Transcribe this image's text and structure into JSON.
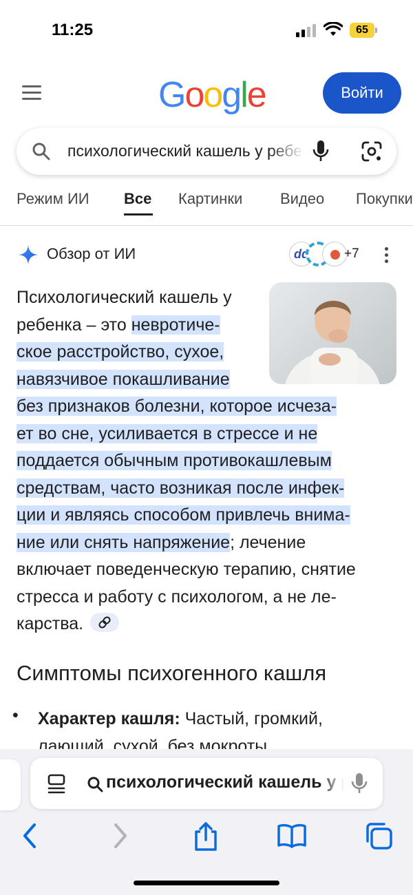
{
  "status_bar": {
    "time": "11:25",
    "battery": "65"
  },
  "header": {
    "logo": [
      "G",
      "o",
      "o",
      "g",
      "l",
      "e"
    ],
    "logo_colors": [
      "#4285F4",
      "#EA4335",
      "#FBBC05",
      "#4285F4",
      "#34A853",
      "#EA4335"
    ],
    "login_label": "Войти"
  },
  "search": {
    "query": "психологический кашель у ребенка"
  },
  "tabs": [
    {
      "label": "Режим ИИ"
    },
    {
      "label": "Все",
      "active": true
    },
    {
      "label": "Картинки"
    },
    {
      "label": "Видео"
    },
    {
      "label": "Покупки"
    }
  ],
  "ai_overview": {
    "title": "Обзор от ИИ",
    "sources_more": "+7",
    "source_logo_text": "dd",
    "lines": [
      {
        "pre": "Психологический кашель у",
        "hl": "",
        "post": ""
      },
      {
        "pre": "ребенка – это ",
        "hl": "невротиче-",
        "post": ""
      },
      {
        "pre": "",
        "hl": "ское расстройство, сухое,",
        "post": ""
      },
      {
        "pre": "",
        "hl": "навязчивое покашливание",
        "post": ""
      },
      {
        "pre": "",
        "hl": "без признаков болезни, которое исчеза-",
        "post": ""
      },
      {
        "pre": "",
        "hl": "ет во сне, усиливается в стрессе и не",
        "post": ""
      },
      {
        "pre": "",
        "hl": "поддается обычным противокашлевым",
        "post": ""
      },
      {
        "pre": "",
        "hl": "средствам, часто возникая после инфек-",
        "post": ""
      },
      {
        "pre": "",
        "hl": "ции и являясь способом привлечь внима-",
        "post": ""
      },
      {
        "pre": "",
        "hl": "ние или снять напряжение",
        "post": "; лечение"
      },
      {
        "pre": "включает поведенческую терапию, снятие",
        "hl": "",
        "post": ""
      },
      {
        "pre": "стресса и работу с психологом, а не ле-",
        "hl": "",
        "post": ""
      },
      {
        "pre": "карства.",
        "hl": "",
        "post": ""
      }
    ]
  },
  "symptoms": {
    "title": "Симптомы психогенного кашля",
    "bullet": "•",
    "item_label": "Характер кашля:",
    "item_text_line1": " Частый, громкий,",
    "item_text_line2": "лающий, сухой, без мокроты."
  },
  "safari": {
    "address_text": "психологический кашель у ребенка"
  },
  "colors": {
    "accent": "#1a56c9",
    "highlight": "#d3e3fd",
    "toolbar_icons": "#0a6bdf"
  }
}
